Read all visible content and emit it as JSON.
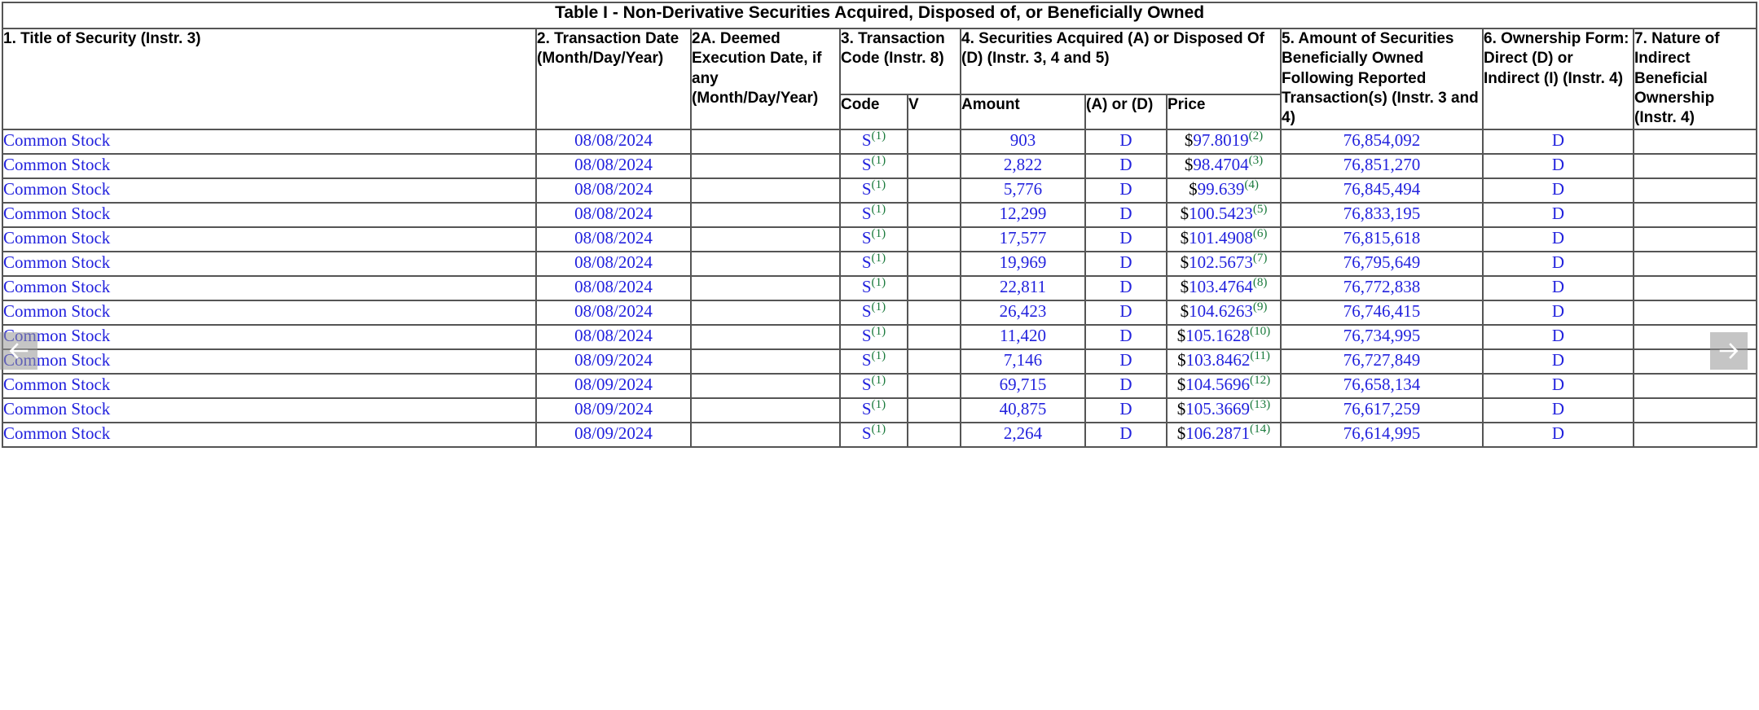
{
  "table": {
    "title": "Table I - Non-Derivative Securities Acquired, Disposed of, or Beneficially Owned",
    "headers": {
      "col1": "1. Title of Security (Instr. 3)",
      "col2": "2. Transaction Date (Month/Day/Year)",
      "col2a": "2A. Deemed Execution Date, if any (Month/Day/Year)",
      "col3": "3. Transaction Code (Instr. 8)",
      "col4": "4. Securities Acquired (A) or Disposed Of (D) (Instr. 3, 4 and 5)",
      "col5": "5. Amount of Securities Beneficially Owned Following Reported Transaction(s) (Instr. 3 and 4)",
      "col6": "6. Ownership Form: Direct (D) or Indirect (I) (Instr. 4)",
      "col7": "7. Nature of Indirect Beneficial Ownership (Instr. 4)"
    },
    "subheaders": {
      "code": "Code",
      "v": "V",
      "amount": "Amount",
      "a_or_d": "(A) or (D)",
      "price": "Price"
    },
    "currency_symbol": "$",
    "rows": [
      {
        "security": "Common Stock",
        "transaction_date": "08/08/2024",
        "deemed_execution_date": "",
        "code": "S",
        "code_footnote": "(1)",
        "v": "",
        "amount": "903",
        "a_or_d": "D",
        "price": "97.8019",
        "price_footnote": "(2)",
        "securities_owned": "76,854,092",
        "ownership_form": "D",
        "nature_indirect": ""
      },
      {
        "security": "Common Stock",
        "transaction_date": "08/08/2024",
        "deemed_execution_date": "",
        "code": "S",
        "code_footnote": "(1)",
        "v": "",
        "amount": "2,822",
        "a_or_d": "D",
        "price": "98.4704",
        "price_footnote": "(3)",
        "securities_owned": "76,851,270",
        "ownership_form": "D",
        "nature_indirect": ""
      },
      {
        "security": "Common Stock",
        "transaction_date": "08/08/2024",
        "deemed_execution_date": "",
        "code": "S",
        "code_footnote": "(1)",
        "v": "",
        "amount": "5,776",
        "a_or_d": "D",
        "price": "99.639",
        "price_footnote": "(4)",
        "securities_owned": "76,845,494",
        "ownership_form": "D",
        "nature_indirect": ""
      },
      {
        "security": "Common Stock",
        "transaction_date": "08/08/2024",
        "deemed_execution_date": "",
        "code": "S",
        "code_footnote": "(1)",
        "v": "",
        "amount": "12,299",
        "a_or_d": "D",
        "price": "100.5423",
        "price_footnote": "(5)",
        "securities_owned": "76,833,195",
        "ownership_form": "D",
        "nature_indirect": ""
      },
      {
        "security": "Common Stock",
        "transaction_date": "08/08/2024",
        "deemed_execution_date": "",
        "code": "S",
        "code_footnote": "(1)",
        "v": "",
        "amount": "17,577",
        "a_or_d": "D",
        "price": "101.4908",
        "price_footnote": "(6)",
        "securities_owned": "76,815,618",
        "ownership_form": "D",
        "nature_indirect": ""
      },
      {
        "security": "Common Stock",
        "transaction_date": "08/08/2024",
        "deemed_execution_date": "",
        "code": "S",
        "code_footnote": "(1)",
        "v": "",
        "amount": "19,969",
        "a_or_d": "D",
        "price": "102.5673",
        "price_footnote": "(7)",
        "securities_owned": "76,795,649",
        "ownership_form": "D",
        "nature_indirect": ""
      },
      {
        "security": "Common Stock",
        "transaction_date": "08/08/2024",
        "deemed_execution_date": "",
        "code": "S",
        "code_footnote": "(1)",
        "v": "",
        "amount": "22,811",
        "a_or_d": "D",
        "price": "103.4764",
        "price_footnote": "(8)",
        "securities_owned": "76,772,838",
        "ownership_form": "D",
        "nature_indirect": ""
      },
      {
        "security": "Common Stock",
        "transaction_date": "08/08/2024",
        "deemed_execution_date": "",
        "code": "S",
        "code_footnote": "(1)",
        "v": "",
        "amount": "26,423",
        "a_or_d": "D",
        "price": "104.6263",
        "price_footnote": "(9)",
        "securities_owned": "76,746,415",
        "ownership_form": "D",
        "nature_indirect": ""
      },
      {
        "security": "Common Stock",
        "transaction_date": "08/08/2024",
        "deemed_execution_date": "",
        "code": "S",
        "code_footnote": "(1)",
        "v": "",
        "amount": "11,420",
        "a_or_d": "D",
        "price": "105.1628",
        "price_footnote": "(10)",
        "securities_owned": "76,734,995",
        "ownership_form": "D",
        "nature_indirect": ""
      },
      {
        "security": "Common Stock",
        "transaction_date": "08/09/2024",
        "deemed_execution_date": "",
        "code": "S",
        "code_footnote": "(1)",
        "v": "",
        "amount": "7,146",
        "a_or_d": "D",
        "price": "103.8462",
        "price_footnote": "(11)",
        "securities_owned": "76,727,849",
        "ownership_form": "D",
        "nature_indirect": ""
      },
      {
        "security": "Common Stock",
        "transaction_date": "08/09/2024",
        "deemed_execution_date": "",
        "code": "S",
        "code_footnote": "(1)",
        "v": "",
        "amount": "69,715",
        "a_or_d": "D",
        "price": "104.5696",
        "price_footnote": "(12)",
        "securities_owned": "76,658,134",
        "ownership_form": "D",
        "nature_indirect": ""
      },
      {
        "security": "Common Stock",
        "transaction_date": "08/09/2024",
        "deemed_execution_date": "",
        "code": "S",
        "code_footnote": "(1)",
        "v": "",
        "amount": "40,875",
        "a_or_d": "D",
        "price": "105.3669",
        "price_footnote": "(13)",
        "securities_owned": "76,617,259",
        "ownership_form": "D",
        "nature_indirect": ""
      },
      {
        "security": "Common Stock",
        "transaction_date": "08/09/2024",
        "deemed_execution_date": "",
        "code": "S",
        "code_footnote": "(1)",
        "v": "",
        "amount": "2,264",
        "a_or_d": "D",
        "price": "106.2871",
        "price_footnote": "(14)",
        "securities_owned": "76,614,995",
        "ownership_form": "D",
        "nature_indirect": ""
      }
    ]
  },
  "carousel": {
    "prev_label": "←",
    "next_label": "→"
  },
  "colors": {
    "link": "#2222dd",
    "footnote": "#1a7a3c",
    "border": "#555555",
    "text": "#000000",
    "overlay": "#969696"
  }
}
